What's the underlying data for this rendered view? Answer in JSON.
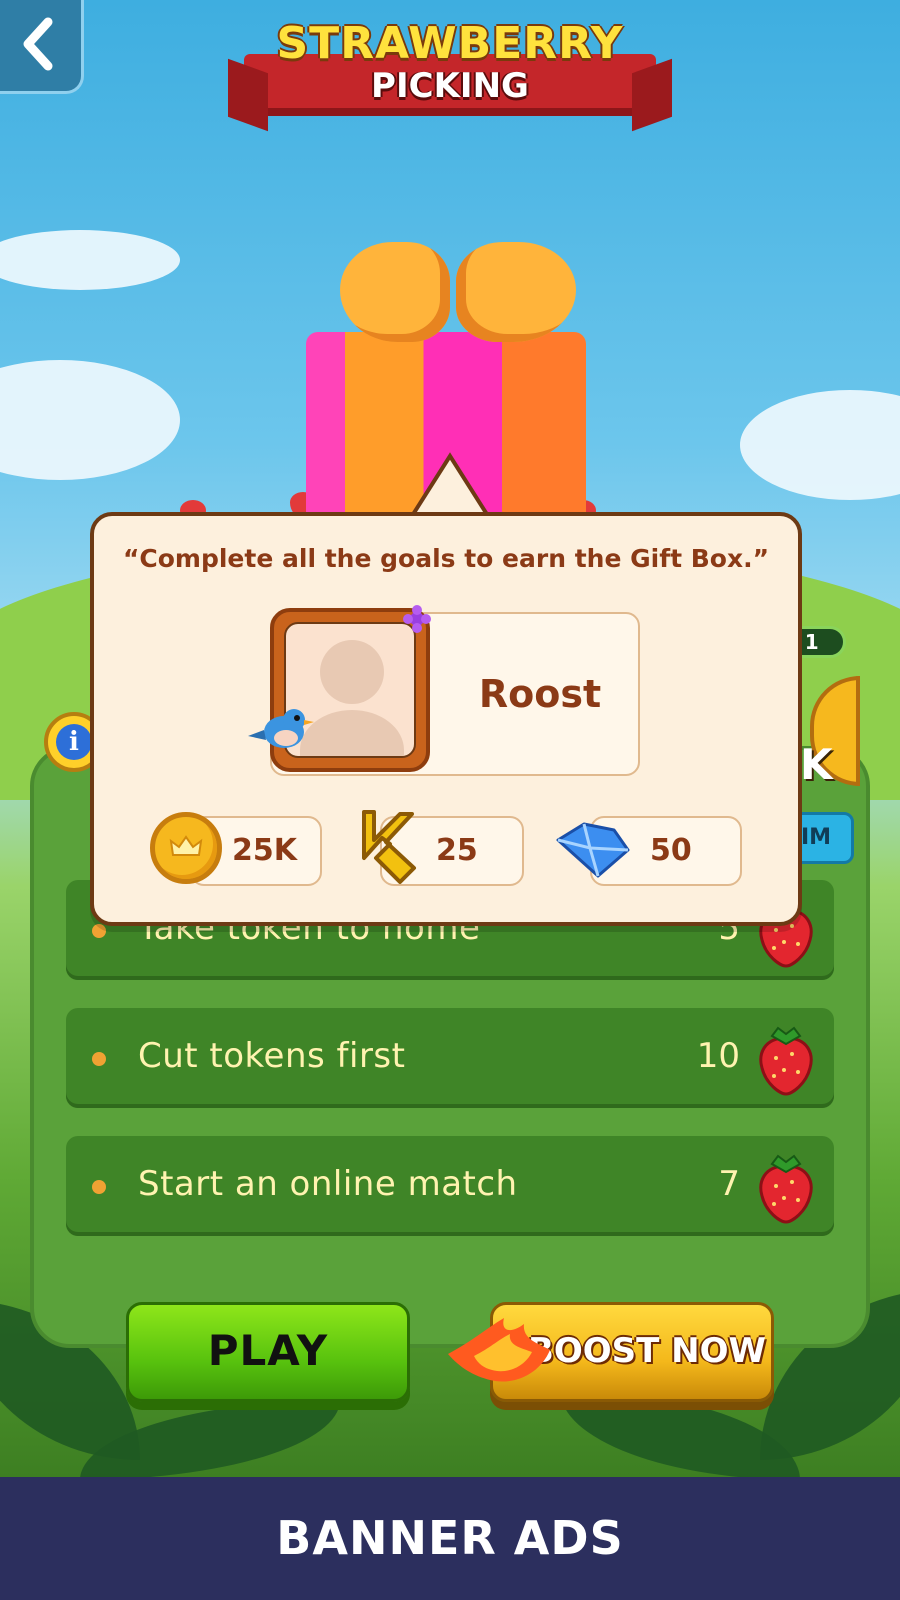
{
  "header": {
    "title_line1": "STRAWBERRY",
    "title_line2": "PICKING",
    "back_icon": "chevron-left-icon"
  },
  "popup": {
    "quote": "“Complete all the goals to earn the Gift Box.”",
    "player_name": "Roost",
    "rewards": [
      {
        "icon": "coin-icon",
        "value": "25K"
      },
      {
        "icon": "k-token-icon",
        "value": "25"
      },
      {
        "icon": "gem-icon",
        "value": "50"
      }
    ]
  },
  "side_peek": {
    "level_text": "L 1",
    "amount_suffix": "K",
    "claim_text": "IM"
  },
  "goals": [
    {
      "label": "Take token to home",
      "count": "5",
      "icon": "strawberry-icon"
    },
    {
      "label": "Cut tokens first",
      "count": "10",
      "icon": "strawberry-icon"
    },
    {
      "label": "Start an online match",
      "count": "7",
      "icon": "strawberry-icon"
    }
  ],
  "buttons": {
    "play": "PLAY",
    "boost": "BOOST NOW"
  },
  "banner": {
    "text": "BANNER ADS"
  },
  "colors": {
    "popup_bg": "#fdf0dd",
    "popup_border": "#6d3a14",
    "panel_green": "#5aa23a",
    "goal_row": "#3f8527",
    "play_green": "#58c20e",
    "boost_yellow": "#f4b81b",
    "banner_bg": "#2c2f5e"
  }
}
